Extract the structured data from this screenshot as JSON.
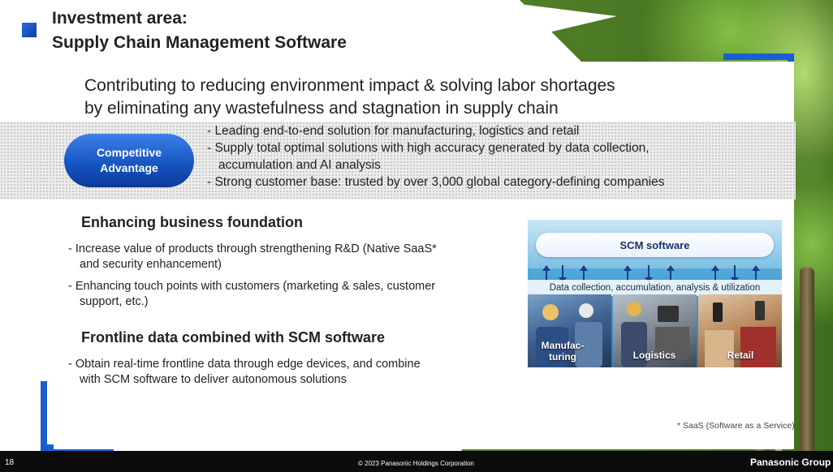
{
  "title_lines": [
    "Investment area:",
    "Supply Chain Management Software"
  ],
  "headline_lines": [
    "Contributing to reducing environment impact & solving labor shortages",
    "by eliminating any wastefulness and stagnation in supply chain"
  ],
  "competitive_advantage": {
    "label_line1": "Competitive",
    "label_line2": "Advantage",
    "items": [
      "- Leading end-to-end solution for manufacturing, logistics and retail",
      "- Supply total optimal solutions with high accuracy generated by data collection,",
      "accumulation and AI analysis",
      "- Strong customer base: trusted by over 3,000 global category-defining companies"
    ]
  },
  "sections": {
    "foundation": {
      "heading": "Enhancing business foundation",
      "bullets": [
        [
          "- Increase value of products through strengthening R&D (Native SaaS*",
          "and security enhancement)"
        ],
        [
          "- Enhancing touch points with customers (marketing & sales, customer",
          "support, etc.)"
        ]
      ]
    },
    "frontline": {
      "heading": "Frontline data combined with SCM software",
      "bullets": [
        [
          "- Obtain real-time frontline data through edge devices, and combine",
          "with SCM software to deliver autonomous solutions"
        ]
      ]
    }
  },
  "scm_diagram": {
    "top_label": "SCM software",
    "middle_label": "Data collection, accumulation, analysis & utilization",
    "segments": [
      {
        "line1": "Manufac-",
        "line2": "turing"
      },
      {
        "line1": "Logistics",
        "line2": ""
      },
      {
        "line1": "Retail",
        "line2": ""
      }
    ]
  },
  "footnote": "* SaaS (Software as a Service)",
  "footer": {
    "page_number": "18",
    "copyright": "© 2023 Panasonic Holdings Corporation",
    "brand": "Panasonic Group"
  },
  "colors": {
    "accent_blue": "#1a5fd1",
    "pill_blue": "#1552bf",
    "diagram_navy": "#1a2f6e"
  }
}
